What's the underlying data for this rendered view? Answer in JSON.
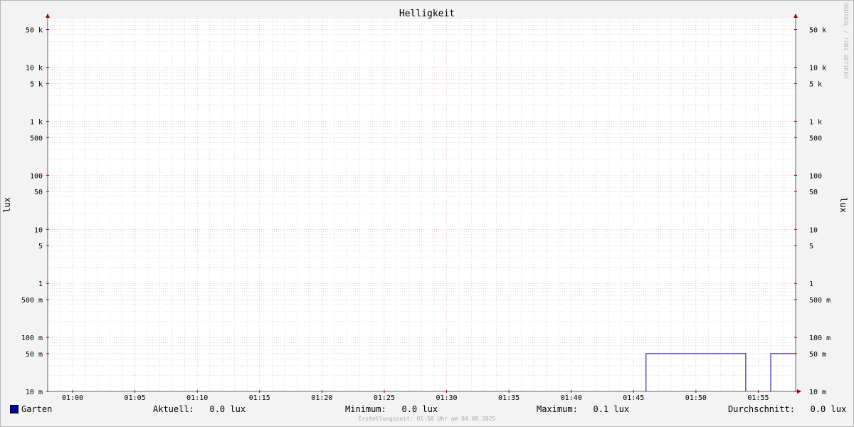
{
  "chart_data": {
    "type": "line",
    "title": "Helligkeit",
    "ylabel": "lux",
    "y_scale": "log",
    "ylim": [
      0.01,
      80000
    ],
    "xlim": [
      "00:58",
      "01:58"
    ],
    "x_ticks": [
      "01:00",
      "01:05",
      "01:10",
      "01:15",
      "01:20",
      "01:25",
      "01:30",
      "01:35",
      "01:40",
      "01:45",
      "01:50",
      "01:55"
    ],
    "y_ticks": [
      {
        "value": 50000,
        "label": "50 k"
      },
      {
        "value": 10000,
        "label": "10 k"
      },
      {
        "value": 5000,
        "label": "5 k"
      },
      {
        "value": 1000,
        "label": "1 k"
      },
      {
        "value": 500,
        "label": "500"
      },
      {
        "value": 100,
        "label": "100"
      },
      {
        "value": 50,
        "label": "50"
      },
      {
        "value": 10,
        "label": "10"
      },
      {
        "value": 5,
        "label": "5"
      },
      {
        "value": 1,
        "label": "1"
      },
      {
        "value": 0.5,
        "label": "500 m"
      },
      {
        "value": 0.1,
        "label": "100 m"
      },
      {
        "value": 0.05,
        "label": "50 m"
      },
      {
        "value": 0.01,
        "label": "10 m"
      }
    ],
    "series": [
      {
        "name": "Garten",
        "color": "#0000a8",
        "x": [
          "00:58",
          "01:46",
          "01:46",
          "01:54",
          "01:54",
          "01:56",
          "01:56",
          "01:58"
        ],
        "values": [
          0.01,
          0.01,
          0.05,
          0.05,
          0.01,
          0.01,
          0.05,
          0.05
        ]
      }
    ],
    "grid": true,
    "grid_major_color": "#e8a0a0",
    "grid_minor_color": "#c8c8c8"
  },
  "legend": {
    "series_name": "Garten",
    "current": "Aktuell:   0.0 lux",
    "minimum": "Minimum:   0.0 lux",
    "maximum": "Maximum:   0.1 lux",
    "average": "Durchschnitt:   0.0 lux"
  },
  "footer": "Erstellungszeit: 01:58 Uhr am 04.08.2025",
  "watermark": "RRDTOOL / TOBI OETIKER"
}
